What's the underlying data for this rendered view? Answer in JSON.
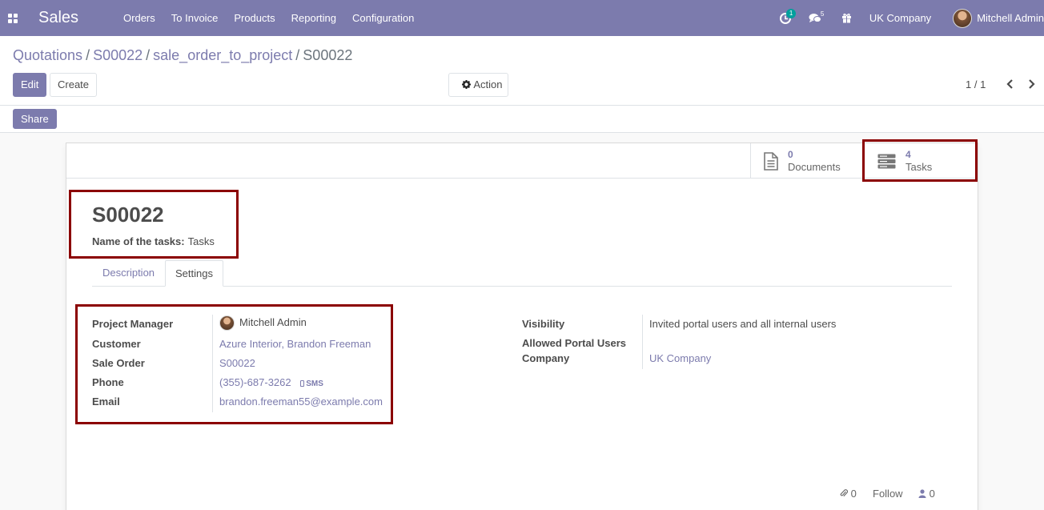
{
  "navbar": {
    "app_name": "Sales",
    "menu": [
      "Orders",
      "To Invoice",
      "Products",
      "Reporting",
      "Configuration"
    ],
    "activity_count": "1",
    "messages_count": "5",
    "company": "UK Company",
    "user": "Mitchell Admin",
    "accent_color": "#7c7bad"
  },
  "breadcrumb": {
    "items": [
      "Quotations",
      "S00022",
      "sale_order_to_project"
    ],
    "current": "S00022"
  },
  "controls": {
    "edit": "Edit",
    "create": "Create",
    "action": "Action",
    "pager": "1 / 1",
    "share": "Share"
  },
  "smart_buttons": {
    "documents": {
      "value": "0",
      "label": "Documents",
      "icon": "file-icon"
    },
    "tasks": {
      "value": "4",
      "label": "Tasks",
      "icon": "tasks-icon"
    }
  },
  "record": {
    "title": "S00022",
    "tasks_name_label": "Name of the tasks:",
    "tasks_name_value": "Tasks"
  },
  "tabs": [
    "Description",
    "Settings"
  ],
  "settings": {
    "left": {
      "project_manager_label": "Project Manager",
      "project_manager": "Mitchell Admin",
      "customer_label": "Customer",
      "customer": "Azure Interior, Brandon Freeman",
      "sale_order_label": "Sale Order",
      "sale_order": "S00022",
      "phone_label": "Phone",
      "phone": "(355)-687-3262",
      "sms": "SMS",
      "email_label": "Email",
      "email": "brandon.freeman55@example.com"
    },
    "right": {
      "visibility_label": "Visibility",
      "visibility": "Invited portal users and all internal users",
      "portal_users_label": "Allowed Portal Users",
      "company_label": "Company",
      "company": "UK Company"
    }
  },
  "chatter": {
    "attachments": "0",
    "follow": "Follow",
    "followers": "0"
  },
  "highlight_color": "#8b0000"
}
